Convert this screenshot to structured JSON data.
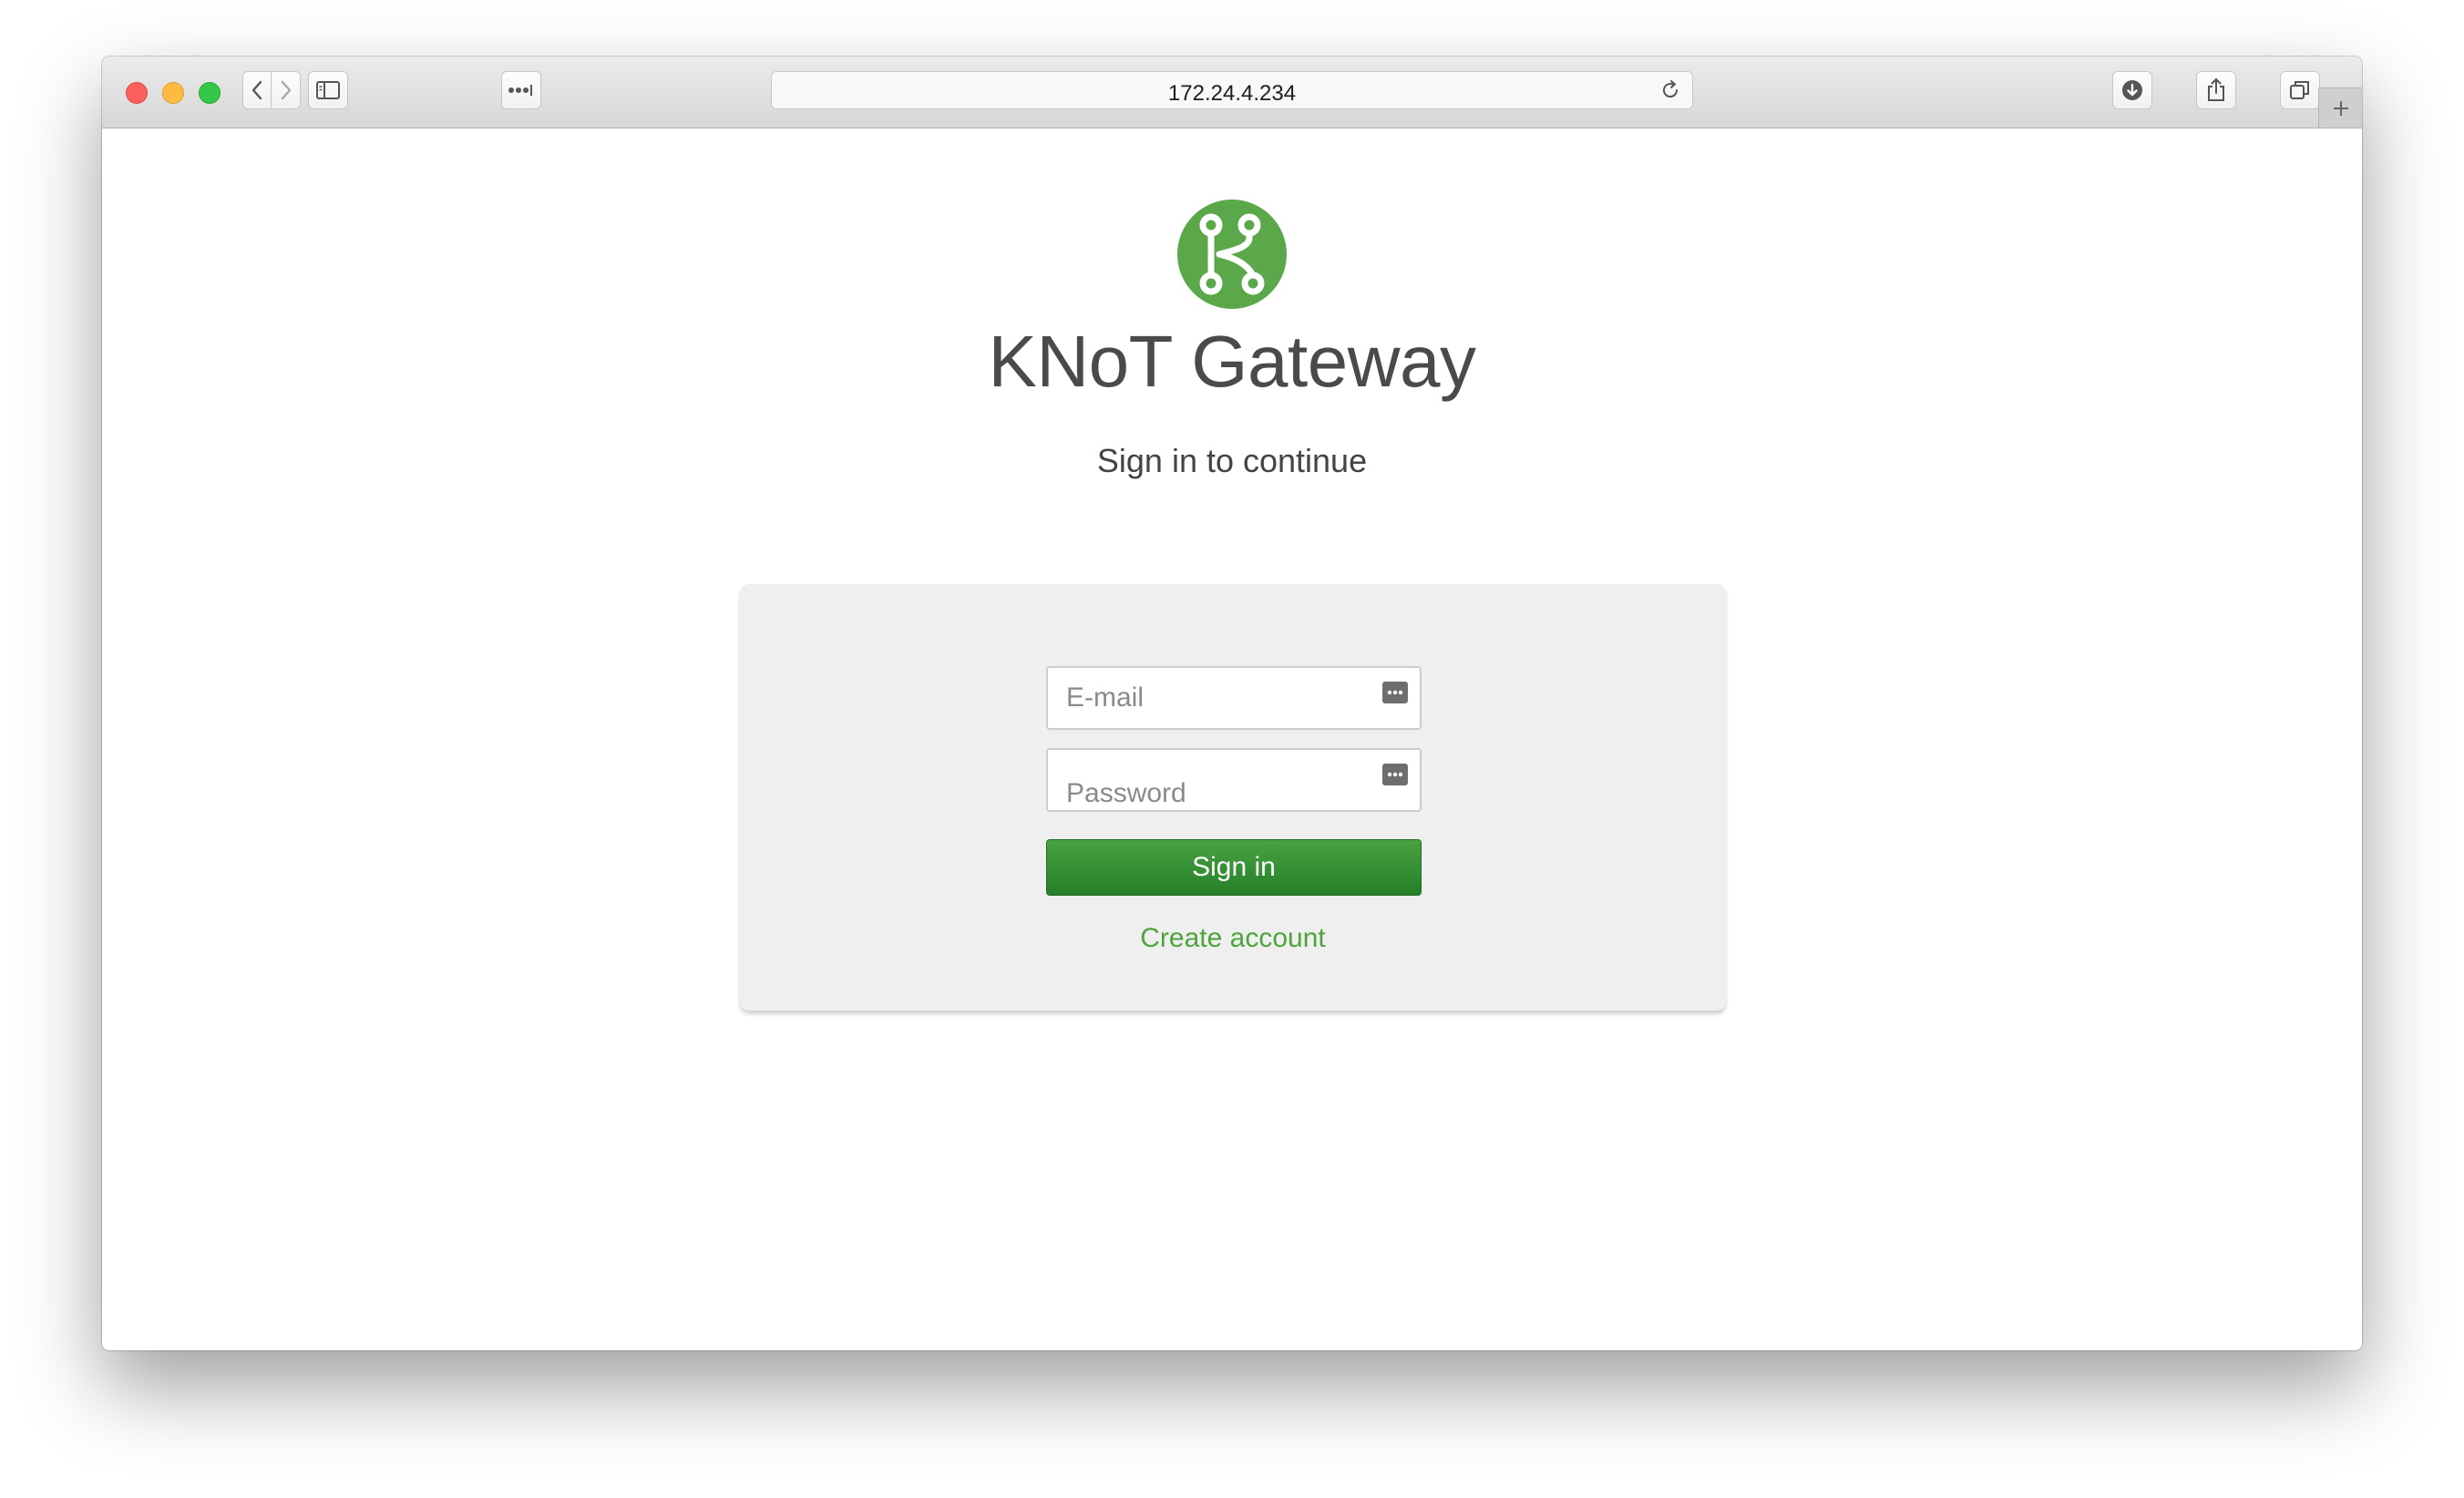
{
  "browser": {
    "address": "172.24.4.234"
  },
  "page": {
    "title": "KNoT Gateway",
    "subtitle": "Sign in to continue"
  },
  "form": {
    "email_placeholder": "E-mail",
    "password_placeholder": "Password",
    "signin_label": "Sign in",
    "create_account_label": "Create account"
  },
  "icons": {
    "logo": "knot-logo-icon",
    "back": "chevron-left-icon",
    "forward": "chevron-right-icon",
    "sidebar": "sidebar-icon",
    "reader": "more-dots-icon",
    "reload": "reload-icon",
    "downloads": "download-icon",
    "share": "share-icon",
    "tabs": "tabs-icon",
    "new_tab": "plus-icon",
    "autofill": "autofill-key-icon"
  },
  "colors": {
    "brand_green": "#5aa84a",
    "button_green": "#2f8a2e",
    "link_green": "#4ea33c"
  }
}
